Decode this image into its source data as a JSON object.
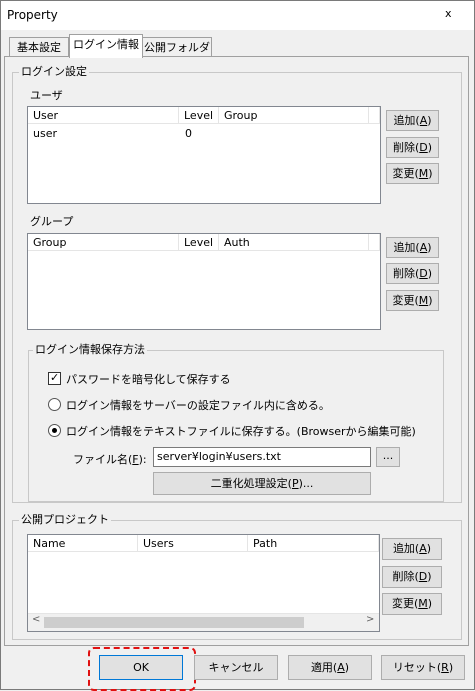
{
  "window": {
    "title": "Property",
    "close": "x"
  },
  "tabs": [
    "基本設定",
    "ログイン情報",
    "公開フォルダ"
  ],
  "login_settings": {
    "legend": "ログイン設定",
    "users": {
      "label": "ユーザ",
      "columns": [
        "User",
        "Level",
        "Group"
      ],
      "rows": [
        {
          "user": "user",
          "level": "0",
          "group": ""
        }
      ]
    },
    "groups": {
      "label": "グループ",
      "columns": [
        "Group",
        "Level",
        "Auth"
      ],
      "rows": []
    },
    "buttons": {
      "add": "追加(",
      "add_key": "A",
      "del": "削除(",
      "del_key": "D",
      "mod": "変更(",
      "mod_key": "M",
      "close_paren": ")"
    },
    "save_method": {
      "legend": "ログイン情報保存方法",
      "encrypt_label": "パスワードを暗号化して保存する",
      "encrypt_checked": true,
      "option_server": "ログイン情報をサーバーの設定ファイル内に含める。",
      "option_text": "ログイン情報をテキストファイルに保存する。(Browserから編集可能)",
      "selected": "text",
      "file_label": "ファイル名(",
      "file_key": "F",
      "file_label_end": "):",
      "file_value": "server¥login¥users.txt",
      "browse": "...",
      "dual": "二重化処理設定(",
      "dual_key": "P",
      "dual_end": ")..."
    }
  },
  "public_projects": {
    "legend": "公開プロジェクト",
    "columns": [
      "Name",
      "Users",
      "Path"
    ],
    "rows": []
  },
  "footer": {
    "ok": "OK",
    "cancel": "キャンセル",
    "apply": "適用(",
    "apply_key": "A",
    "reset": "リセット(",
    "reset_key": "R",
    "close_paren": ")"
  }
}
